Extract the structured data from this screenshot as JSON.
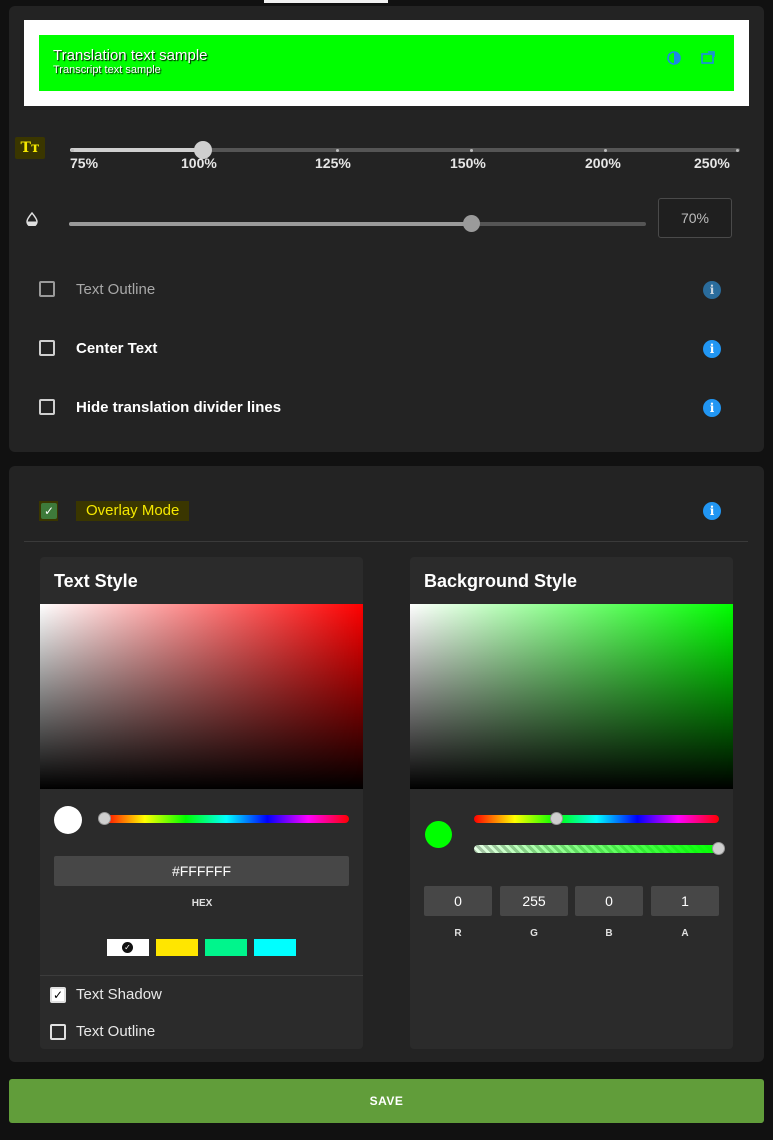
{
  "preview": {
    "translation_text": "Translation text sample",
    "transcript_text": "Transcript text sample",
    "bg_color": "#00FF00",
    "icons": [
      "contrast-icon",
      "popout-icon"
    ]
  },
  "font_size": {
    "icon_label": "Tт",
    "options": [
      "75%",
      "100%",
      "125%",
      "150%",
      "200%",
      "250%"
    ],
    "selected": "100%"
  },
  "opacity": {
    "value_text": "70%",
    "level_percent": 70
  },
  "options": [
    {
      "label": "Text Outline",
      "checked": false,
      "enabled": false
    },
    {
      "label": "Center Text",
      "checked": false,
      "enabled": true
    },
    {
      "label": "Hide translation divider lines",
      "checked": false,
      "enabled": true
    }
  ],
  "overlay": {
    "label": "Overlay Mode",
    "checked": true
  },
  "text_style": {
    "title": "Text Style",
    "hex_value": "#FFFFFF",
    "hex_label": "HEX",
    "hue_color": "#FF0000",
    "current_color": "#FFFFFF",
    "presets": [
      "#FFFFFF",
      "#FFE600",
      "#00F58C",
      "#00FFFF"
    ],
    "text_shadow_label": "Text Shadow",
    "text_shadow_checked": true,
    "text_outline_label": "Text Outline",
    "text_outline_checked": false
  },
  "background_style": {
    "title": "Background Style",
    "hue_color": "#00FF00",
    "current_color": "#00FF00",
    "r": "0",
    "g": "255",
    "b": "0",
    "a": "1",
    "labels": {
      "r": "R",
      "g": "G",
      "b": "B",
      "a": "A"
    }
  },
  "save_label": "SAVE"
}
